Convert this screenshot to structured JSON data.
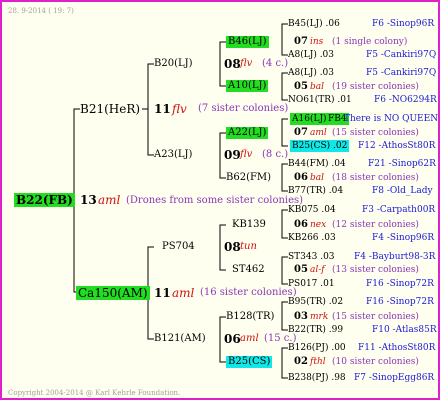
{
  "header": {
    "date": "28. 9-2014 ( 19: 7)"
  },
  "footer": {
    "copyright": "Copyright 2004-2014 @ Karl Kehrle Foundation."
  },
  "root": {
    "name": "B22(FB)",
    "num": "13",
    "race": "aml",
    "note": "(Drones from some sister colonies)"
  },
  "upper": {
    "name": "B21(HeR)",
    "num": "11",
    "race": "flv",
    "note": "(7 sister colonies)"
  },
  "lower": {
    "name": "Ca150(AM)",
    "num": "11",
    "race": "aml",
    "note": "(16 sister colonies)"
  },
  "b20": {
    "name": "B20(LJ)",
    "num": "08",
    "race": "flv",
    "note": "(4 c.)"
  },
  "a23": {
    "name": "A23(LJ)",
    "num": "09",
    "race": "flv",
    "note": "(8 c.)"
  },
  "ps704": {
    "name": "PS704",
    "num": "08",
    "race": "tun"
  },
  "b121": {
    "name": "B121(AM)",
    "num": "06",
    "race": "aml",
    "note": "(15 c.)"
  },
  "g3": [
    {
      "name": "B46(LJ)",
      "num": "07",
      "race": "ins",
      "note": "(1 single colony)",
      "top": "B45(LJ) .06",
      "topid": "F6 -Sinop96R",
      "bot": "A8(LJ) .03",
      "botid": "F5 -Cankiri97Q"
    },
    {
      "name": "A10(LJ)",
      "num": "05",
      "race": "bal",
      "note": "(19 sister colonies)",
      "top": "A8(LJ) .03",
      "topid": "F5 -Cankiri97Q",
      "bot": "NO61(TR) .01",
      "botid": "F6 -NO6294R"
    },
    {
      "name": "A22(LJ)",
      "num": "07",
      "race": "aml",
      "note": "(15 sister colonies)",
      "top": "A16(LJ)",
      "topmid": "FB4",
      "topid": "There is NO QUEEN",
      "bot": "B25(CS) .02",
      "botid": "F12 -AthosSt80R"
    },
    {
      "name": "B62(FM)",
      "num": "06",
      "race": "bal",
      "note": "(18 sister colonies)",
      "top": "B44(FM) .04",
      "topid": "F21 -Sinop62R",
      "bot": "B77(TR) .04",
      "botid": "F8 -Old_Lady"
    },
    {
      "name": "KB139",
      "num": "06",
      "race": "nex",
      "note": "(12 sister colonies)",
      "top": "KB075 .04",
      "topid": "F3 -Carpath00R",
      "bot": "KB266 .03",
      "botid": "F4 -Sinop96R"
    },
    {
      "name": "ST462",
      "num": "05",
      "race": "al-f",
      "note": "(13 sister colonies)",
      "top": "ST343 .03",
      "topid": "F4 -Bayburt98-3R",
      "bot": "PS017 .01",
      "botid": "F16 -Sinop72R"
    },
    {
      "name": "B128(TR)",
      "num": "03",
      "race": "mrk",
      "note": "(15 sister colonies)",
      "top": "B95(TR) .02",
      "topid": "F16 -Sinop72R",
      "bot": "B22(TR) .99",
      "botid": "F10 -Atlas85R"
    },
    {
      "name": "B25(CS)",
      "num": "02",
      "race": "fthl",
      "note": "(10 sister colonies)",
      "top": "B126(PJ) .00",
      "topid": "F11 -AthosSt80R",
      "bot": "B238(PJ) .98",
      "botid": "F7 -SinopEgg86R"
    }
  ]
}
